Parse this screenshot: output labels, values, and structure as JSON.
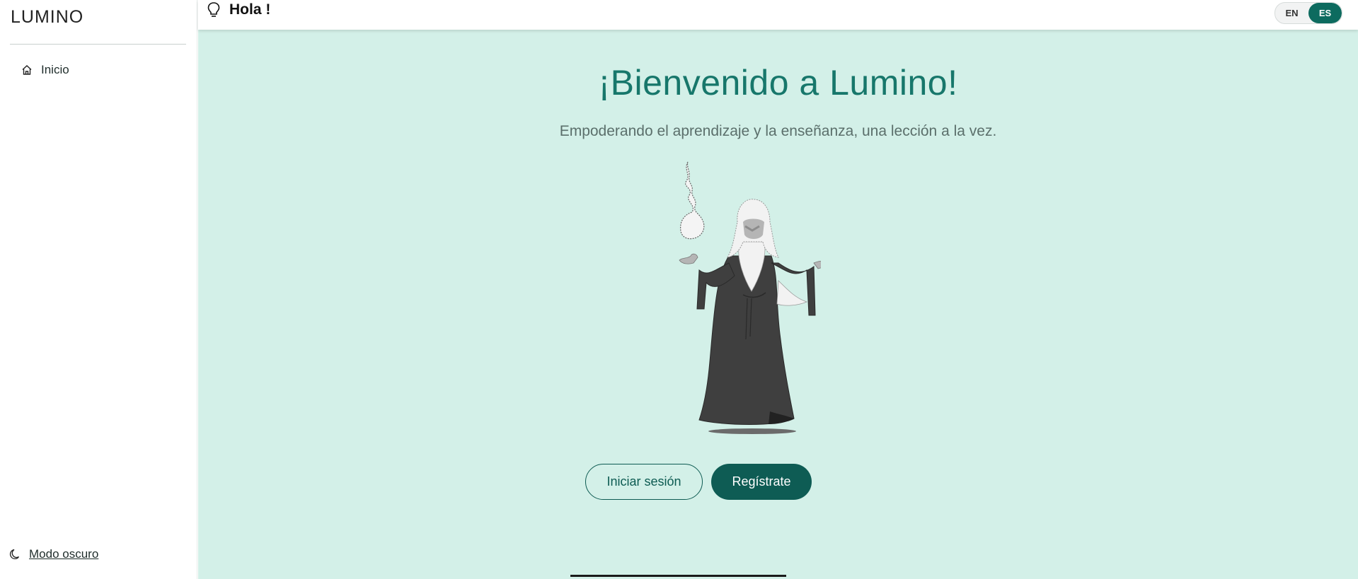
{
  "sidebar": {
    "brand": "LUMINO",
    "items": [
      {
        "label": "Inicio",
        "icon": "home-icon"
      }
    ],
    "dark_mode_label": "Modo oscuro"
  },
  "header": {
    "greeting": "Hola !",
    "languages": [
      {
        "label": "EN",
        "active": false
      },
      {
        "label": "ES",
        "active": true
      }
    ]
  },
  "hero": {
    "title": "¡Bienvenido a Lumino!",
    "subtitle": "Empoderando el aprendizaje y la enseñanza, una lección a la vez.",
    "login_label": "Iniciar sesión",
    "register_label": "Regístrate"
  },
  "colors": {
    "accent": "#0e5c54",
    "title": "#17776b",
    "background": "#d3f0e8"
  }
}
